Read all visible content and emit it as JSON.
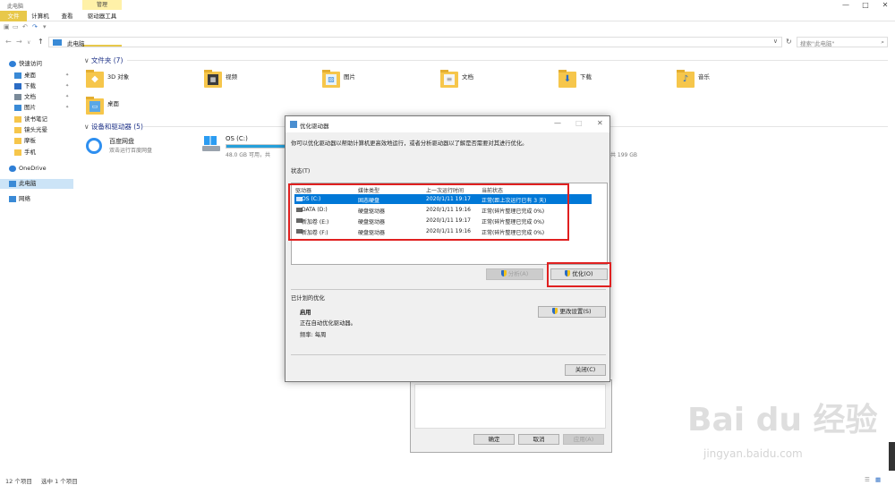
{
  "window": {
    "title": "此电脑",
    "manage_tag": "管理",
    "min": "—",
    "max": "□",
    "close": "✕"
  },
  "ribbon": {
    "file": "文件",
    "computer": "计算机",
    "view": "查看",
    "drive_tools": "驱动器工具"
  },
  "address": {
    "back": "←",
    "forward": "→",
    "recent": "∨",
    "up": "↑",
    "crumb": "此电脑",
    "dropdown": "∨",
    "refresh": "↻",
    "search_placeholder": "搜索\"此电脑\"",
    "search_icon": "⌕"
  },
  "sidebar": {
    "items": [
      {
        "label": "快速访问",
        "color": "#2f7fd6"
      },
      {
        "label": "桌面",
        "color": "#3a8ad6",
        "pin": "📌"
      },
      {
        "label": "下载",
        "color": "#2b6cc4",
        "pin": "📌"
      },
      {
        "label": "文档",
        "color": "#7a8a99",
        "pin": "📌"
      },
      {
        "label": "图片",
        "color": "#3a8ad6",
        "pin": "📌"
      },
      {
        "label": "读书笔记",
        "color": "#f6c64b"
      },
      {
        "label": "镜头光晕",
        "color": "#f6c64b"
      },
      {
        "label": "摩板",
        "color": "#f6c64b"
      },
      {
        "label": "手机",
        "color": "#f6c64b"
      },
      {
        "label": "OneDrive",
        "color": "#2f7fd6"
      },
      {
        "label": "此电脑",
        "color": "#3a8ad6"
      },
      {
        "label": "网络",
        "color": "#3a8ad6"
      }
    ]
  },
  "folders_section": {
    "header": "文件夹 (7)",
    "items": [
      "3D 对象",
      "视频",
      "图片",
      "文档",
      "下载",
      "音乐",
      "桌面"
    ]
  },
  "drives_section": {
    "header": "设备和驱动器 (5)",
    "baidu": {
      "name": "百度网盘",
      "sub": "双击运行百度网盘"
    },
    "os": {
      "name": "OS (C:)",
      "sub": "48.0 GB 可用，共",
      "fill_fraction": 0.62
    },
    "far_sub": "共 199 GB"
  },
  "status_bar": {
    "count": "12 个项目",
    "selected": "选中 1 个项目"
  },
  "bg_dialog": {
    "ok": "确定",
    "cancel": "取消",
    "apply": "应用(A)"
  },
  "dialog": {
    "title": "优化驱动器",
    "min": "—",
    "max": "□",
    "close": "✕",
    "description": "你可以优化驱动器以帮助计算机更高效地运行，或者分析驱动器以了解是否需要对其进行优化。",
    "status_label": "状态(T)",
    "columns": [
      "驱动器",
      "媒体类型",
      "上一次运行时间",
      "当前状态"
    ],
    "rows": [
      {
        "drive": "OS (C:)",
        "media": "固态硬盘",
        "last": "2020/1/11 19:17",
        "status": "正常(距上次运行已有 3 天)"
      },
      {
        "drive": "DATA (D:)",
        "media": "硬盘驱动器",
        "last": "2020/1/11 19:16",
        "status": "正常(碎片整理已完成 0%)"
      },
      {
        "drive": "新加卷 (E:)",
        "media": "硬盘驱动器",
        "last": "2020/1/11 19:17",
        "status": "正常(碎片整理已完成 0%)"
      },
      {
        "drive": "新加卷 (F:)",
        "media": "硬盘驱动器",
        "last": "2020/1/11 19:16",
        "status": "正常(碎片整理已完成 0%)"
      }
    ],
    "analyze": "分析(A)",
    "optimize": "优化(O)",
    "scheduled_label": "已计划的优化",
    "sched_state": "启用",
    "sched_desc": "正在自动优化驱动器。",
    "sched_freq": "频率: 每周",
    "change_settings": "更改设置(S)",
    "close_button": "关闭(C)"
  },
  "watermark": {
    "logo": "Bai du 经验",
    "url": "jingyan.baidu.com"
  }
}
